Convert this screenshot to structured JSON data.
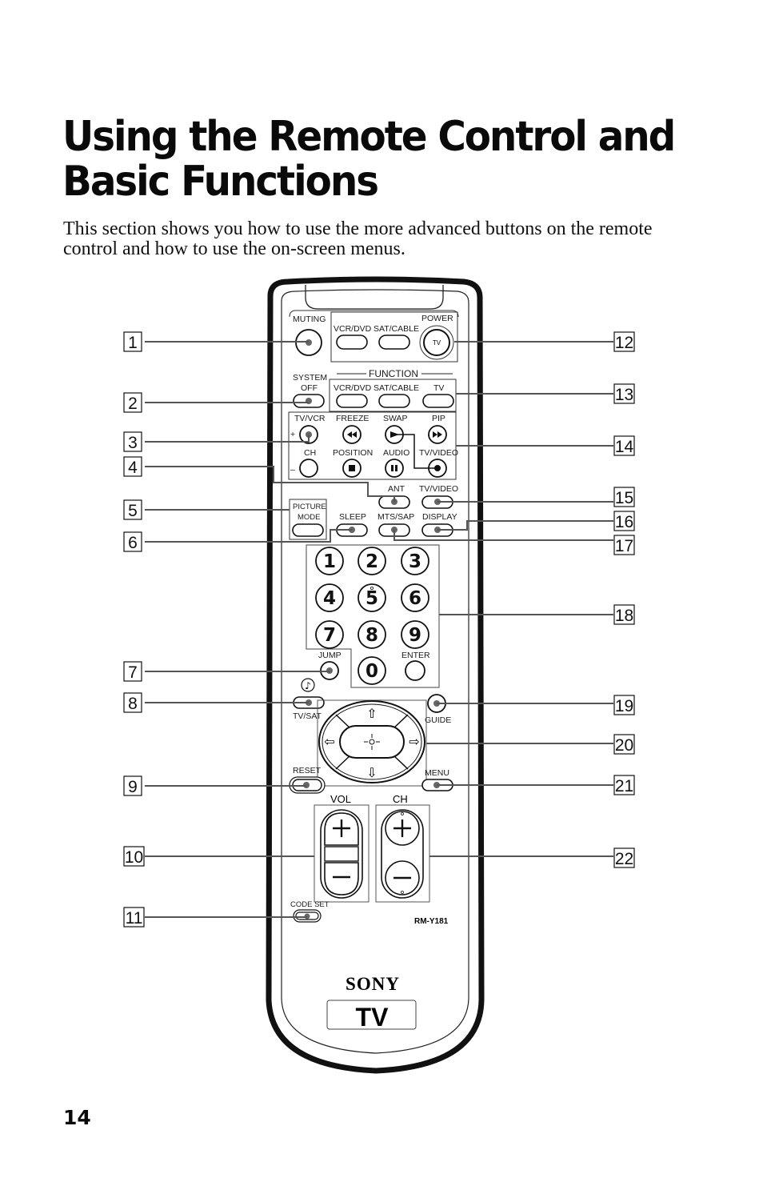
{
  "page": {
    "title_line1": "Using the Remote Control and",
    "title_line2": "Basic Functions",
    "intro": "This section shows you how to use the more advanced buttons on the remote control and how to use the on-screen menus.",
    "page_number": "14"
  },
  "remote": {
    "model": "RM-Y181",
    "brand": "SONY",
    "badge": "TV",
    "labels": {
      "muting": "MUTING",
      "power": "POWER",
      "power_tv": "TV",
      "vcr_dvd": "VCR/DVD",
      "sat_cable": "SAT/CABLE",
      "system": "SYSTEM",
      "off": "OFF",
      "function": "FUNCTION",
      "func_vcr_dvd": "VCR/DVD",
      "func_sat_cable": "SAT/CABLE",
      "func_tv": "TV",
      "tv_vcr": "TV/VCR",
      "freeze": "FREEZE",
      "swap": "SWAP",
      "pip": "PIP",
      "ch_small": "CH",
      "position": "POSITION",
      "audio": "AUDIO",
      "tv_video_pip": "TV/VIDEO",
      "plus": "+",
      "minus": "–",
      "ant": "ANT",
      "tv_video": "TV/VIDEO",
      "picture": "PICTURE",
      "mode": "MODE",
      "sleep": "SLEEP",
      "mts_sap": "MTS/SAP",
      "display": "DISPLAY",
      "jump": "JUMP",
      "enter": "ENTER",
      "tv_sat": "TV/SAT",
      "guide": "GUIDE",
      "reset": "RESET",
      "menu": "MENU",
      "vol": "VOL",
      "ch": "CH",
      "code_set": "CODE SET"
    },
    "digits": [
      "1",
      "2",
      "3",
      "4",
      "5",
      "6",
      "7",
      "8",
      "9",
      "0"
    ],
    "music_note": "♪",
    "arrows": {
      "up": "⇧",
      "down": "⇩",
      "left": "⇦",
      "right": "⇨"
    }
  },
  "callouts": [
    "1",
    "2",
    "3",
    "4",
    "5",
    "6",
    "7",
    "8",
    "9",
    "10",
    "11",
    "12",
    "13",
    "14",
    "15",
    "16",
    "17",
    "18",
    "19",
    "20",
    "21",
    "22"
  ]
}
